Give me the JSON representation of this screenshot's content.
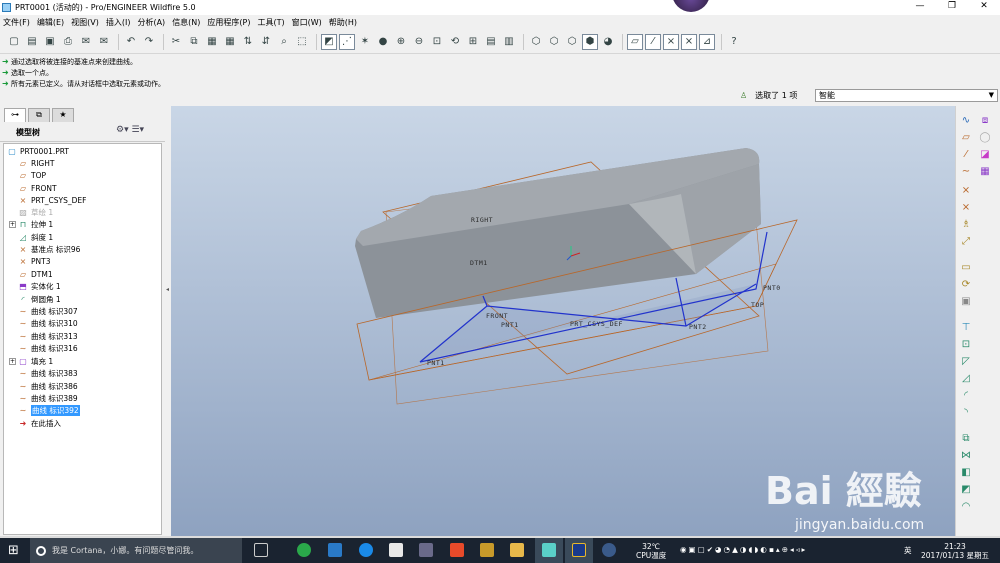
{
  "window": {
    "title": "PRT0001 (活动的) - Pro/ENGINEER Wildfire 5.0",
    "controls": [
      "—",
      "❐",
      "✕"
    ]
  },
  "menu": [
    "文件(F)",
    "编辑(E)",
    "视图(V)",
    "插入(I)",
    "分析(A)",
    "信息(N)",
    "应用程序(P)",
    "工具(T)",
    "窗口(W)",
    "帮助(H)"
  ],
  "messages": [
    "通过选取将被连接的基准点来创建曲线。",
    "选取一个点。",
    "所有元素已定义。请从对话框中选取元素或动作。"
  ],
  "selection": {
    "status": "选取了 1 项",
    "filter_value": "智能"
  },
  "model_tree": {
    "title": "模型树",
    "items": [
      {
        "label": "PRT0001.PRT",
        "icon": "part-icon"
      },
      {
        "label": "RIGHT",
        "icon": "datum-plane-icon"
      },
      {
        "label": "TOP",
        "icon": "datum-plane-icon"
      },
      {
        "label": "FRONT",
        "icon": "datum-plane-icon"
      },
      {
        "label": "PRT_CSYS_DEF",
        "icon": "csys-icon"
      },
      {
        "label": "草绘 1",
        "icon": "sketch-icon"
      },
      {
        "label": "拉伸 1",
        "icon": "extrude-icon"
      },
      {
        "label": "斜度 1",
        "icon": "draft-icon"
      },
      {
        "label": "基准点 标识96",
        "icon": "datum-point-icon"
      },
      {
        "label": "PNT3",
        "icon": "datum-point-icon"
      },
      {
        "label": "DTM1",
        "icon": "datum-plane-icon"
      },
      {
        "label": "实体化 1",
        "icon": "solidify-icon"
      },
      {
        "label": "倒圆角 1",
        "icon": "round-icon"
      },
      {
        "label": "曲线 标识307",
        "icon": "curve-icon"
      },
      {
        "label": "曲线 标识310",
        "icon": "curve-icon"
      },
      {
        "label": "曲线 标识313",
        "icon": "curve-icon"
      },
      {
        "label": "曲线 标识316",
        "icon": "curve-icon"
      },
      {
        "label": "填充 1",
        "icon": "fill-icon"
      },
      {
        "label": "曲线 标识383",
        "icon": "curve-icon"
      },
      {
        "label": "曲线 标识386",
        "icon": "curve-icon"
      },
      {
        "label": "曲线 标识389",
        "icon": "curve-icon"
      },
      {
        "label": "曲线 标识392",
        "icon": "curve-icon"
      },
      {
        "label": "在此插入",
        "icon": "insert-arrow-icon"
      }
    ]
  },
  "datum_labels": {
    "right": "RIGHT",
    "dtm1": "DTM1",
    "front": "FRONT",
    "pnt1": "PNT1",
    "csys": "PRT_CSYS_DEF",
    "pnt2": "PNT2",
    "top": "TOP",
    "pnt0": "PNT0",
    "pnt_bottom": "PNT1"
  },
  "watermark": {
    "logo": "Bai 經驗",
    "url": "jingyan.baidu.com"
  },
  "taskbar": {
    "search_placeholder": "我是 Cortana，小娜。有问题尽管问我。",
    "weather": "32℃",
    "weather_label": "CPU温度",
    "ime": "英",
    "time": "21:23",
    "date": "2017/01/13 星期五"
  },
  "colors": {
    "datum_plane": "#b8672a",
    "curve": "#2233cc",
    "model": "#8c9299"
  }
}
